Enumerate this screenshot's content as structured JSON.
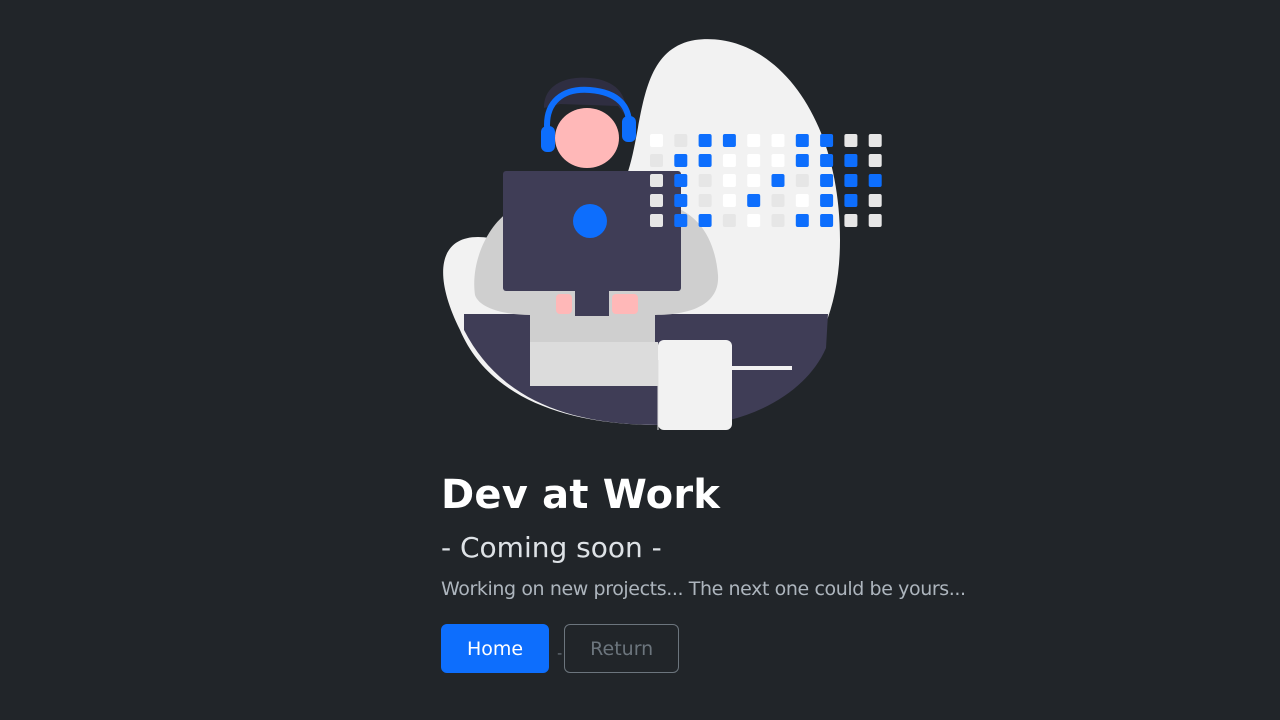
{
  "hero": {
    "title": "Dev at Work",
    "subtitle": "- Coming soon -",
    "lead": "Working on new projects... The next one could be yours..."
  },
  "actions": {
    "home_label": "Home",
    "separator": "-",
    "return_label": "Return"
  },
  "colors": {
    "background": "#212529",
    "accent": "#0d6efd",
    "illustration_dark": "#3f3d56",
    "illustration_light": "#f2f2f2",
    "skin": "#ffb8b8"
  },
  "illustration": {
    "icon": "developer-at-computer-illustration"
  }
}
